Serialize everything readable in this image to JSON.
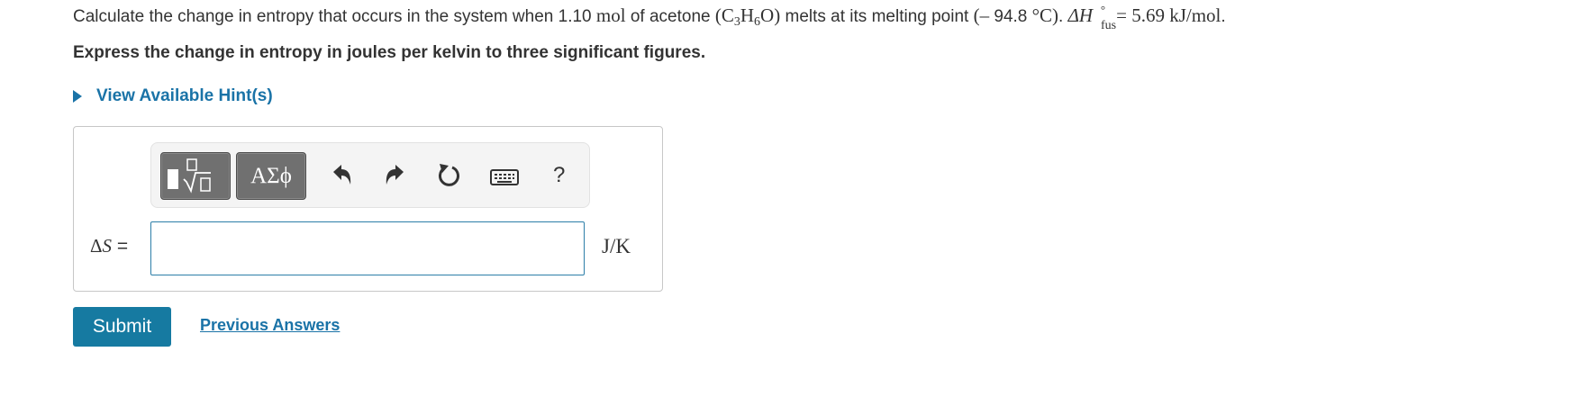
{
  "question": {
    "p1": "Calculate the change in entropy that occurs in the system when 1.10 ",
    "unit_mol": "mol",
    "p2": " of acetone ",
    "formula_open": "(C",
    "c_sub": "3",
    "h": "H",
    "h_sub": "6",
    "formula_close": "O)",
    "p3": " melts at its melting point ",
    "temp_open": "(",
    "temp_dash": "–",
    "temp_value": " 94.8 ",
    "temp_unit": "°C)",
    "p4": ". ",
    "delta_h": "ΔH",
    "h_sup": "°",
    "h_subscript": "fus",
    "enthalpy_value": "= 5.69 kJ/mol",
    "p5": "."
  },
  "instructions": "Express the change in entropy in joules per kelvin to three significant figures.",
  "hint_link": "View Available Hint(s)",
  "toolbar": {
    "symbols_label": "ΑΣϕ",
    "help_label": "?"
  },
  "answer": {
    "label_delta": "Δ",
    "label_var": "S",
    "label_eq": " =",
    "value": "",
    "unit": "J/K"
  },
  "submit_label": "Submit",
  "previous_answers_label": "Previous Answers",
  "colors": {
    "link": "#1a73a7",
    "submit": "#167aa1",
    "input_border": "#2c7ea8",
    "toolbar_button": "#707070"
  }
}
